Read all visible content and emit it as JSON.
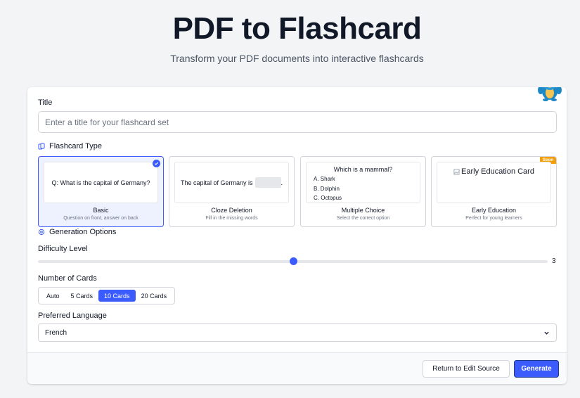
{
  "header": {
    "title": "PDF to Flashcard",
    "subtitle": "Transform your PDF documents into interactive flashcards"
  },
  "form": {
    "title_label": "Title",
    "title_placeholder": "Enter a title for your flashcard set",
    "type_section_label": "Flashcard Type",
    "types": [
      {
        "name": "Basic",
        "desc": "Question on front, answer on back",
        "preview": "Q: What is the capital of Germany?",
        "selected": true
      },
      {
        "name": "Cloze Deletion",
        "desc": "Fill in the missing words",
        "preview_before": "The capital of Germany is",
        "preview_after": "."
      },
      {
        "name": "Multiple Choice",
        "desc": "Select the correct option",
        "question": "Which is a mammal?",
        "options": [
          "A. Shark",
          "B. Dolphin",
          "C. Octopus"
        ]
      },
      {
        "name": "Early Education",
        "desc": "Perfect for young learners",
        "preview": "Early Education Card",
        "badge": "Soon"
      }
    ],
    "options_section_label": "Generation Options",
    "difficulty_label": "Difficulty Level",
    "difficulty_value": "3",
    "difficulty_fraction": 0.5,
    "cards_label": "Number of Cards",
    "card_options": [
      "Auto",
      "5 Cards",
      "10 Cards",
      "20 Cards"
    ],
    "selected_cards": "10 Cards",
    "language_label": "Preferred Language",
    "language_value": "French"
  },
  "footer": {
    "return_label": "Return to Edit Source",
    "generate_label": "Generate"
  },
  "colors": {
    "accent": "#3b5bfd",
    "badge": "#f59e0b"
  }
}
